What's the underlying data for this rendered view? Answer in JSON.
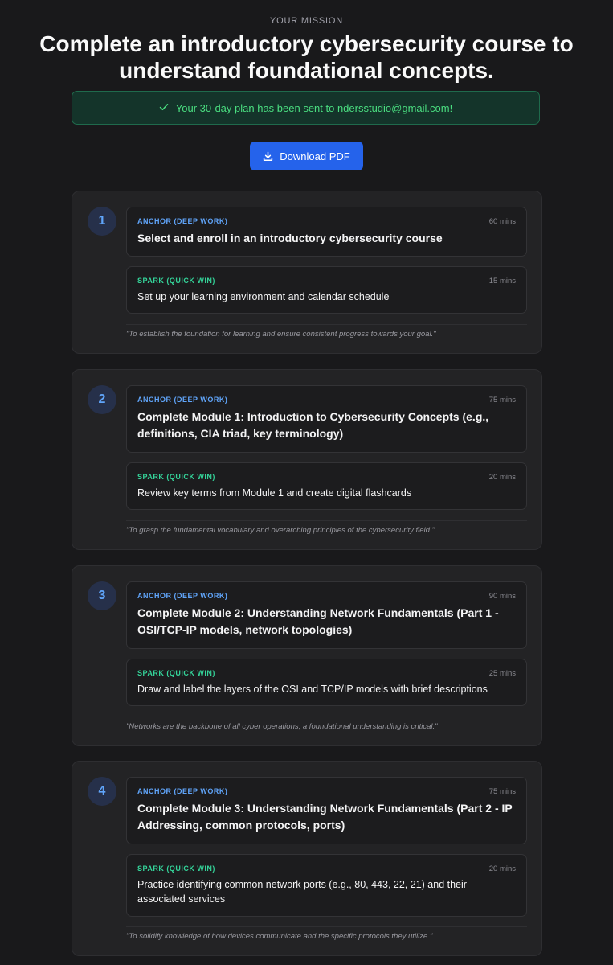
{
  "header": {
    "label": "YOUR MISSION",
    "title": "Complete an introductory cybersecurity course to understand foundational concepts."
  },
  "banner": {
    "icon": "check-icon",
    "text": "Your 30-day plan has been sent to ndersstudio@gmail.com!",
    "color": "#4ade80"
  },
  "download": {
    "icon": "download-icon",
    "label": "Download PDF",
    "color": "#2563eb"
  },
  "steps": [
    {
      "number": "1",
      "anchor": {
        "type": "ANCHOR (DEEP WORK)",
        "title": "Select and enroll in an introductory cybersecurity course",
        "duration": "60 mins"
      },
      "spark": {
        "type": "SPARK (QUICK WIN)",
        "title": "Set up your learning environment and calendar schedule",
        "duration": "15 mins"
      },
      "rationale": "\"To establish the foundation for learning and ensure consistent progress towards your goal.\""
    },
    {
      "number": "2",
      "anchor": {
        "type": "ANCHOR (DEEP WORK)",
        "title": "Complete Module 1: Introduction to Cybersecurity Concepts (e.g., definitions, CIA triad, key terminology)",
        "duration": "75 mins"
      },
      "spark": {
        "type": "SPARK (QUICK WIN)",
        "title": "Review key terms from Module 1 and create digital flashcards",
        "duration": "20 mins"
      },
      "rationale": "\"To grasp the fundamental vocabulary and overarching principles of the cybersecurity field.\""
    },
    {
      "number": "3",
      "anchor": {
        "type": "ANCHOR (DEEP WORK)",
        "title": "Complete Module 2: Understanding Network Fundamentals (Part 1 - OSI/TCP-IP models, network topologies)",
        "duration": "90 mins"
      },
      "spark": {
        "type": "SPARK (QUICK WIN)",
        "title": "Draw and label the layers of the OSI and TCP/IP models with brief descriptions",
        "duration": "25 mins"
      },
      "rationale": "\"Networks are the backbone of all cyber operations; a foundational understanding is critical.\""
    },
    {
      "number": "4",
      "anchor": {
        "type": "ANCHOR (DEEP WORK)",
        "title": "Complete Module 3: Understanding Network Fundamentals (Part 2 - IP Addressing, common protocols, ports)",
        "duration": "75 mins"
      },
      "spark": {
        "type": "SPARK (QUICK WIN)",
        "title": "Practice identifying common network ports (e.g., 80, 443, 22, 21) and their associated services",
        "duration": "20 mins"
      },
      "rationale": "\"To solidify knowledge of how devices communicate and the specific protocols they utilize.\""
    }
  ]
}
